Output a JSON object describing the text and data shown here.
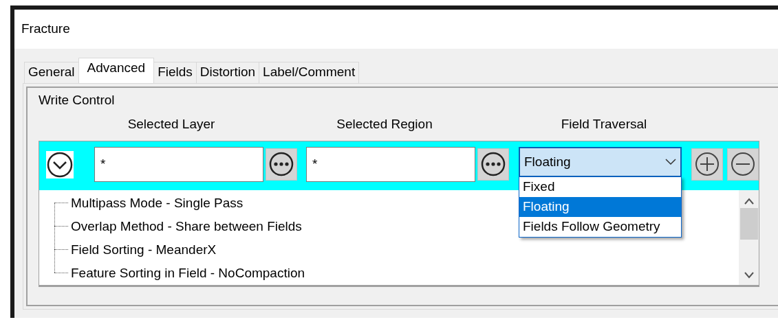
{
  "window": {
    "title": "Fracture"
  },
  "tabs": [
    {
      "label": "General",
      "selected": false
    },
    {
      "label": "Advanced",
      "selected": true
    },
    {
      "label": "Fields",
      "selected": false
    },
    {
      "label": "Distortion",
      "selected": false
    },
    {
      "label": "Label/Comment",
      "selected": false
    }
  ],
  "group": {
    "title": "Write Control"
  },
  "columns": [
    "Selected Layer",
    "Selected Region",
    "Field Traversal"
  ],
  "row": {
    "layer": {
      "value": "*"
    },
    "region": {
      "value": "*"
    },
    "traversal": {
      "value": "Floating"
    }
  },
  "dropdown": {
    "options": [
      {
        "label": "Fixed",
        "selected": false
      },
      {
        "label": "Floating",
        "selected": true
      },
      {
        "label": "Fields Follow Geometry",
        "selected": false
      }
    ]
  },
  "tree": {
    "items": [
      "Multipass Mode - Single Pass",
      "Overlap Method - Share between Fields",
      "Field Sorting - MeanderX",
      "Feature Sorting in Field - NoCompaction"
    ]
  }
}
